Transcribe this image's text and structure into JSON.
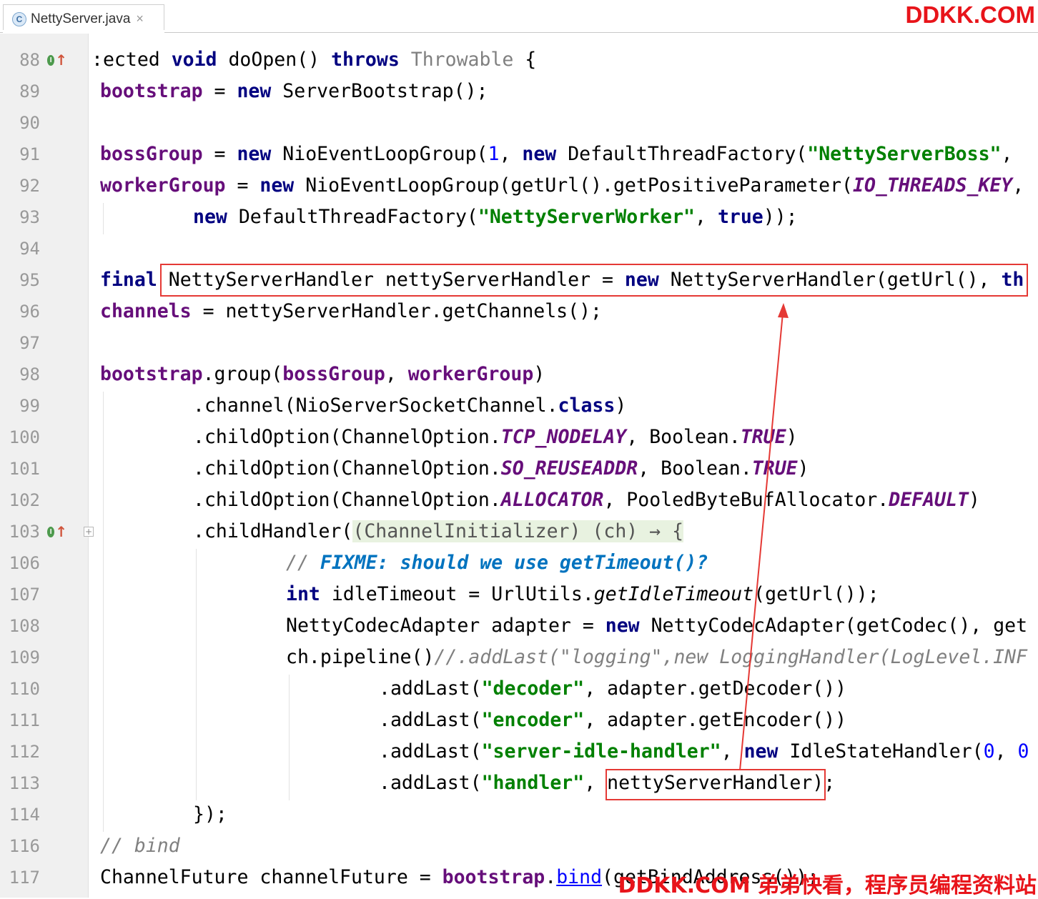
{
  "tab": {
    "file_icon_letter": "C",
    "title": "NettyServer.java",
    "close_glyph": "×"
  },
  "watermarks": {
    "top": "DDKK.COM",
    "bottom": "DDKK.COM 弟弟快看，程序员编程资料站"
  },
  "gutter": {
    "line_numbers": [
      "88",
      "89",
      "90",
      "91",
      "92",
      "93",
      "94",
      "95",
      "96",
      "97",
      "98",
      "99",
      "100",
      "101",
      "102",
      "103",
      "106",
      "107",
      "108",
      "109",
      "110",
      "111",
      "112",
      "113",
      "114",
      "116",
      "117"
    ],
    "override_icon_letter": "I",
    "override_arrow": "↑",
    "fold_glyph": "+"
  },
  "colors": {
    "keyword": "#000080",
    "field": "#660e7a",
    "string": "#008000",
    "number": "#0000ff",
    "comment": "#808080",
    "todo": "#0073bf",
    "annotation": "#e53935",
    "watermark": "#e8141a"
  },
  "code": {
    "l88": {
      "a": ":ected ",
      "b": "void",
      "c": " doOpen() ",
      "d": "throws",
      "e": " Throwable",
      "f": " {"
    },
    "l89": {
      "a": "bootstrap",
      "b": " = ",
      "c": "new",
      "d": " ServerBootstrap();"
    },
    "l91": {
      "a": "bossGroup",
      "b": " = ",
      "c": "new",
      "d": " NioEventLoopGroup(",
      "e": "1",
      "f": ", ",
      "g": "new",
      "h": " DefaultThreadFactory(",
      "i": "\"NettyServerBoss\"",
      "j": ","
    },
    "l92": {
      "a": "workerGroup",
      "b": " = ",
      "c": "new",
      "d": " NioEventLoopGroup(getUrl().getPositiveParameter(",
      "e": "IO_THREADS_KEY",
      "f": ","
    },
    "l93": {
      "a": "new",
      "b": " DefaultThreadFactory(",
      "c": "\"NettyServerWorker\"",
      "d": ", ",
      "e": "true",
      "f": "));"
    },
    "l95": {
      "a": "final",
      "b": " NettyServerHandler nettyServerHandler = ",
      "c": "new",
      "d": " NettyServerHandler(getUrl(), ",
      "e": "th"
    },
    "l96": {
      "a": "channels",
      "b": " = nettyServerHandler.getChannels();"
    },
    "l98": {
      "a": "bootstrap",
      "b": ".group(",
      "c": "bossGroup",
      "d": ", ",
      "e": "workerGroup",
      "f": ")"
    },
    "l99": {
      "a": ".channel(NioServerSocketChannel.",
      "b": "class",
      "c": ")"
    },
    "l100": {
      "a": ".childOption(ChannelOption.",
      "b": "TCP_NODELAY",
      "c": ", Boolean.",
      "d": "TRUE",
      "e": ")"
    },
    "l101": {
      "a": ".childOption(ChannelOption.",
      "b": "SO_REUSEADDR",
      "c": ", Boolean.",
      "d": "TRUE",
      "e": ")"
    },
    "l102": {
      "a": ".childOption(ChannelOption.",
      "b": "ALLOCATOR",
      "c": ", PooledByteBufAllocator.",
      "d": "DEFAULT",
      "e": ")"
    },
    "l103": {
      "a": ".childHandler(",
      "b": "(ChannelInitializer) (ch) → {"
    },
    "l106": {
      "a": "// ",
      "b": "FIXME: should we use getTimeout()?"
    },
    "l107": {
      "a": "int",
      "b": " idleTimeout = UrlUtils.",
      "c": "getIdleTimeout",
      "d": "(getUrl());"
    },
    "l108": {
      "a": "NettyCodecAdapter adapter = ",
      "b": "new",
      "c": " NettyCodecAdapter(getCodec(), get"
    },
    "l109": {
      "a": "ch.pipeline()",
      "b": "//.addLast(\"logging\",new LoggingHandler(LogLevel.INF"
    },
    "l110": {
      "a": ".addLast(",
      "b": "\"decoder\"",
      "c": ", adapter.getDecoder())"
    },
    "l111": {
      "a": ".addLast(",
      "b": "\"encoder\"",
      "c": ", adapter.getEncoder())"
    },
    "l112": {
      "a": ".addLast(",
      "b": "\"server-idle-handler\"",
      "c": ", ",
      "d": "new",
      "e": " IdleStateHandler(",
      "f": "0",
      "g": ", ",
      "h": "0"
    },
    "l113": {
      "a": ".addLast(",
      "b": "\"handler\"",
      "c": ", ",
      "d": "nettyServerHandler",
      "e": ");"
    },
    "l114": {
      "a": "});"
    },
    "l116": {
      "a": "// bind"
    },
    "l117": {
      "a": "ChannelFuture channelFuture = ",
      "b": "bootstrap",
      "c": ".",
      "d": "bind",
      "e": "(getBindAddress());"
    }
  }
}
